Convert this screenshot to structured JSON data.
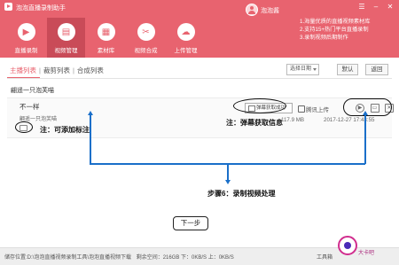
{
  "app": {
    "title": "泡泡直播录制助手",
    "username": "泡泡酱",
    "controls": [
      "☰",
      "–",
      "✕"
    ]
  },
  "notice": [
    "1.海量优质的直播视频素材库",
    "2.支持15+热门平台直播录制",
    "3.录制视频后期制作"
  ],
  "nav": [
    {
      "label": "直播录制",
      "icon": "live-record-icon",
      "glyph": "▶",
      "active": false
    },
    {
      "label": "视频管理",
      "icon": "video-manage-icon",
      "glyph": "▤",
      "active": true
    },
    {
      "label": "素材库",
      "icon": "material-library-icon",
      "glyph": "▦",
      "active": false
    },
    {
      "label": "视频合成",
      "icon": "video-compose-icon",
      "glyph": "✂",
      "active": false
    },
    {
      "label": "上传管理",
      "icon": "upload-manage-icon",
      "glyph": "☁",
      "active": false
    }
  ],
  "tabs": {
    "anchor_list": "主播列表",
    "separator": "|",
    "clip_list": "裁剪列表",
    "compose_list": "合成列表"
  },
  "filters": {
    "select_date": "选择日期",
    "confirm": "默认",
    "return": "返回"
  },
  "anchor": {
    "name": "翩遥一只泡芙喵"
  },
  "video": {
    "title": "不一样",
    "subtitle": "翩遥一只泡芙喵",
    "danmaku_label": "弹幕获取成功",
    "cloud_upload": "腾讯上传",
    "size": "117.9 MB",
    "date": "2017-12-27 17:43:55"
  },
  "annotations": {
    "tag_note": "注：可添加标注",
    "danmaku_note": "注：弹幕获取信息",
    "step_note": "步骤6：录制视频处理"
  },
  "next_button": "下一步",
  "footer": {
    "storage": "储存位置:D:\\泡泡直播视频录制工具\\泡泡直播视频下载",
    "stats": "剩余空间：216GB    下：0KB/S    上：0KB/S",
    "toolbox": "工具箱",
    "watermark": "大卡吧"
  },
  "colors": {
    "header": "#e8636f",
    "nav_active": "#c94b58",
    "annotation_line": "#1a6fc9"
  }
}
